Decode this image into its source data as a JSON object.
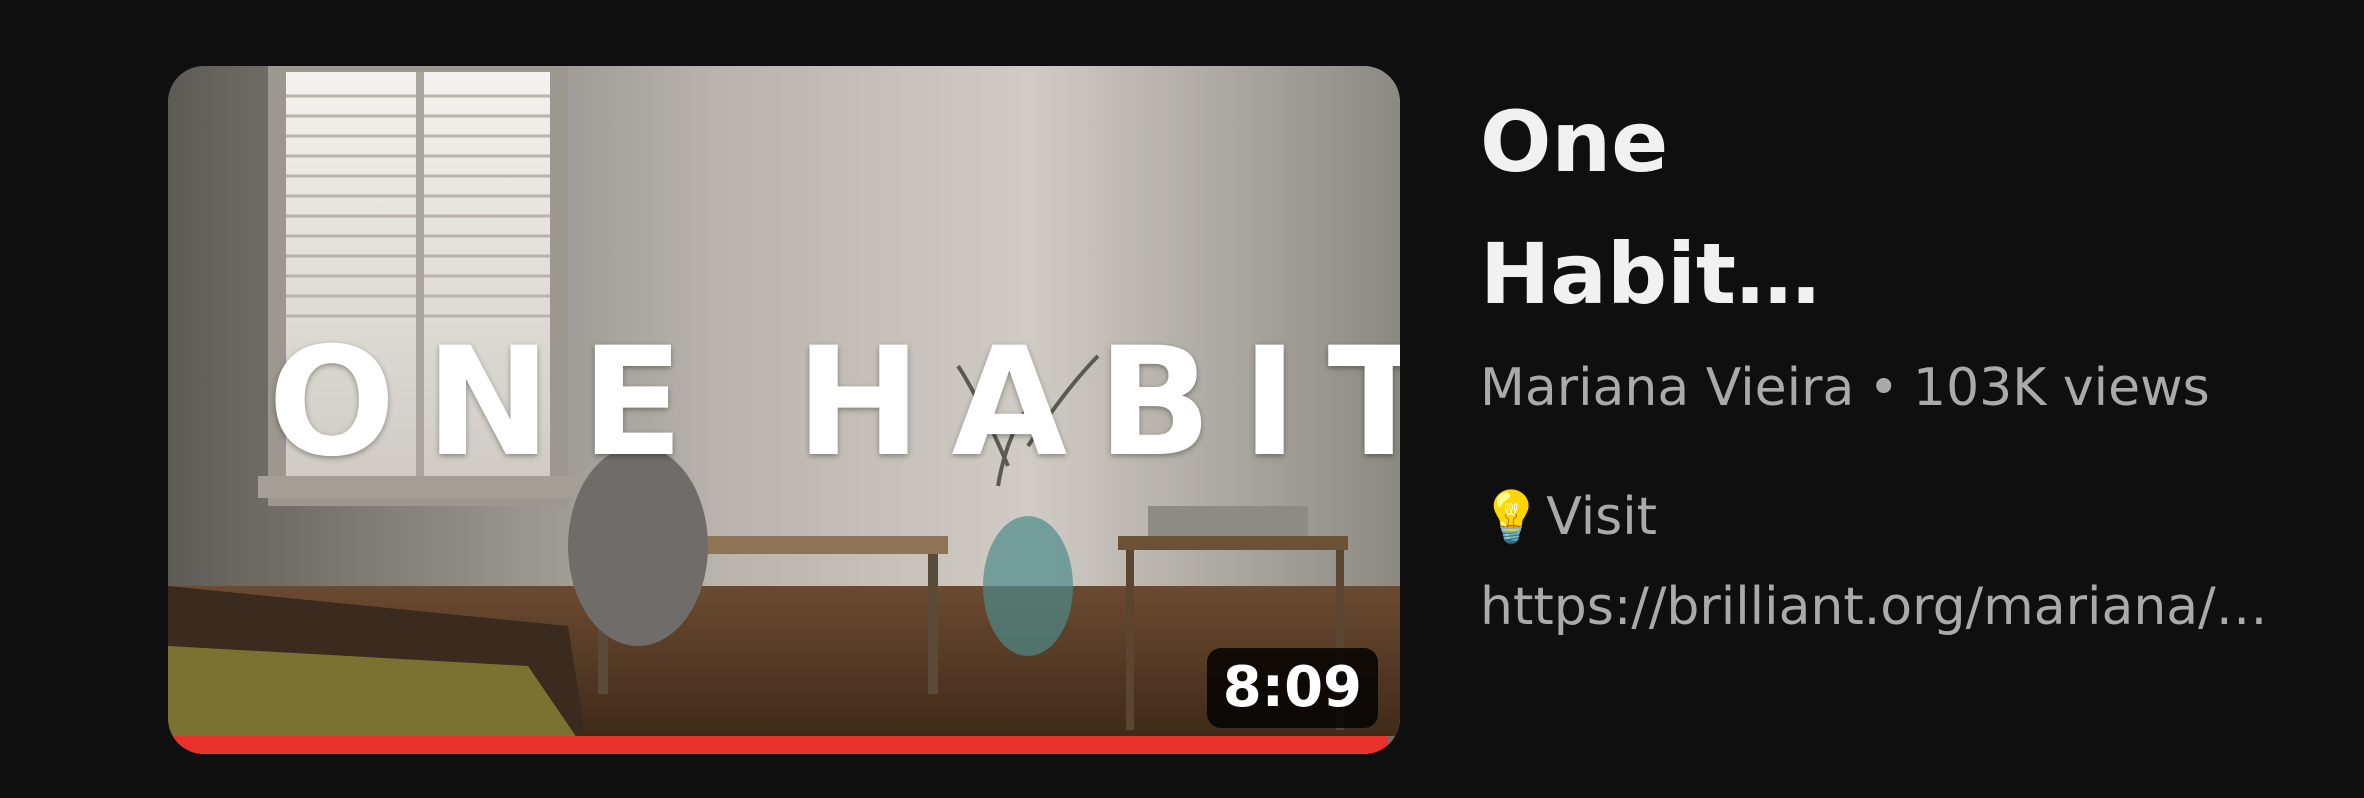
{
  "video": {
    "thumbnail_overlay_text": "ONE HABIT.",
    "duration": "8:09",
    "watch_progress_fraction": 0.99,
    "title_line1": "One",
    "title_line2": "Habit…",
    "channel": "Mariana Vieira",
    "separator": "•",
    "views": "103K views",
    "description_icon": "lightbulb-icon",
    "description_icon_glyph": "💡",
    "description_line1": "Visit",
    "description_line2": "https://brilliant.org/mariana/…"
  },
  "colors": {
    "background": "#0f0f0f",
    "title": "#f1f1f1",
    "secondary_text": "#aaaaaa",
    "progress": "#e8312b"
  }
}
